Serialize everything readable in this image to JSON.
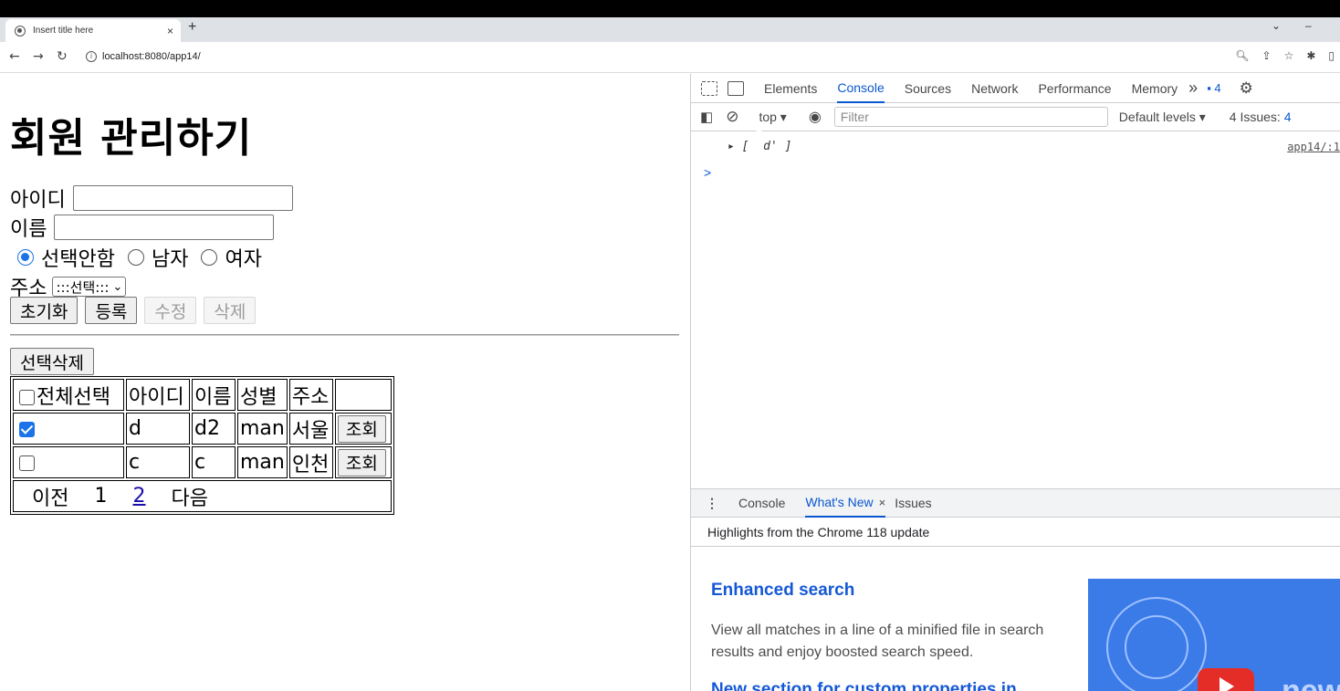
{
  "browser": {
    "tab_title": "Insert title here",
    "tab_close": "×",
    "new_tab": "+",
    "url": "localhost:8080/app14/",
    "win_chevron": "⌄",
    "win_minimize": "–"
  },
  "page": {
    "heading": "회원 관리하기",
    "id_label": "아이디",
    "name_label": "이름",
    "gender_options": [
      "선택안함",
      "남자",
      "여자"
    ],
    "address_label": "주소",
    "address_selected": ":::선택:::",
    "buttons": {
      "reset": "초기화",
      "register": "등록",
      "edit": "수정",
      "delete": "삭제"
    },
    "delete_selected": "선택삭제",
    "table": {
      "headers": [
        "전체선택",
        "아이디",
        "이름",
        "성별",
        "주소",
        ""
      ],
      "rows": [
        {
          "checked": true,
          "id": "d",
          "name": "d2",
          "gender": "man",
          "address": "서울",
          "action": "조회"
        },
        {
          "checked": false,
          "id": "c",
          "name": "c",
          "gender": "man",
          "address": "인천",
          "action": "조회"
        }
      ],
      "pager": {
        "prev": "이전",
        "pages": [
          "1",
          "2"
        ],
        "next": "다음"
      }
    }
  },
  "devtools": {
    "tabs": [
      "Elements",
      "Console",
      "Sources",
      "Network",
      "Performance",
      "Memory"
    ],
    "active_tab": "Console",
    "more": "»",
    "issue_count": "4",
    "context": "top",
    "filter_placeholder": "Filter",
    "levels": "Default levels ▾",
    "issues": "4 Issues:",
    "issues_count": "4",
    "console_output": "▸ [ 'd' ]",
    "console_source": "app14/:1",
    "prompt": ">",
    "drawer_tabs": [
      "Console",
      "What's New",
      "Issues"
    ],
    "drawer_active": "What's New",
    "drawer_close": "×",
    "highlights": "Highlights from the Chrome 118 update",
    "feature_title": "Enhanced search",
    "feature_desc": "View all matches in a line of a minified file in search results and enjoy boosted search speed.",
    "next_title": "New section for custom properties in",
    "thumb_text": "new"
  }
}
